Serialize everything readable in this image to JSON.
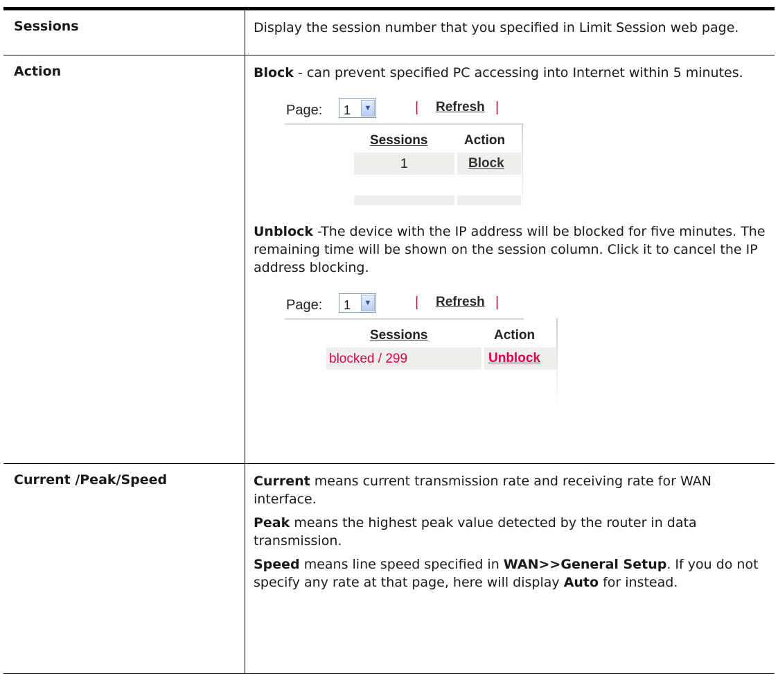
{
  "rows": [
    {
      "term": "Sessions",
      "desc": "Display the session number that you specified in Limit Session web page."
    },
    {
      "term": "Action",
      "block_label": "Block",
      "block_text": " - can prevent specified PC accessing into Internet within 5 minutes.",
      "unblock_label": "Unblock",
      "unblock_text": " -The device with the IP address will be blocked for five minutes. The remaining time will be shown on the session column. Click it to cancel the IP address blocking."
    },
    {
      "term": "Current /Peak/Speed",
      "current_label": "Current",
      "current_text": " means current transmission rate and receiving rate for WAN interface.",
      "peak_label": "Peak",
      "peak_text": " means the highest peak value detected by the router in data transmission.",
      "speed_label": "Speed",
      "speed_text_1": " means line speed specified in ",
      "speed_path": "WAN>>General Setup",
      "speed_text_2": ". If you do not specify any rate at that page, here will display ",
      "speed_auto": "Auto",
      "speed_text_3": " for instead."
    }
  ],
  "shot1": {
    "page_label": "Page:",
    "page_value": "1",
    "refresh": "Refresh",
    "pipe": "|",
    "col_sessions": "Sessions",
    "col_action": "Action",
    "session_value": "1",
    "action_value": "Block"
  },
  "shot2": {
    "page_label": "Page:",
    "page_value": "1",
    "refresh": "Refresh",
    "pipe": "|",
    "col_sessions": "Sessions",
    "col_action": "Action",
    "session_value": "blocked / 299",
    "action_value": "Unblock"
  },
  "colors": {
    "accent_red": "#e0004d",
    "select_border": "#7f9db9"
  }
}
